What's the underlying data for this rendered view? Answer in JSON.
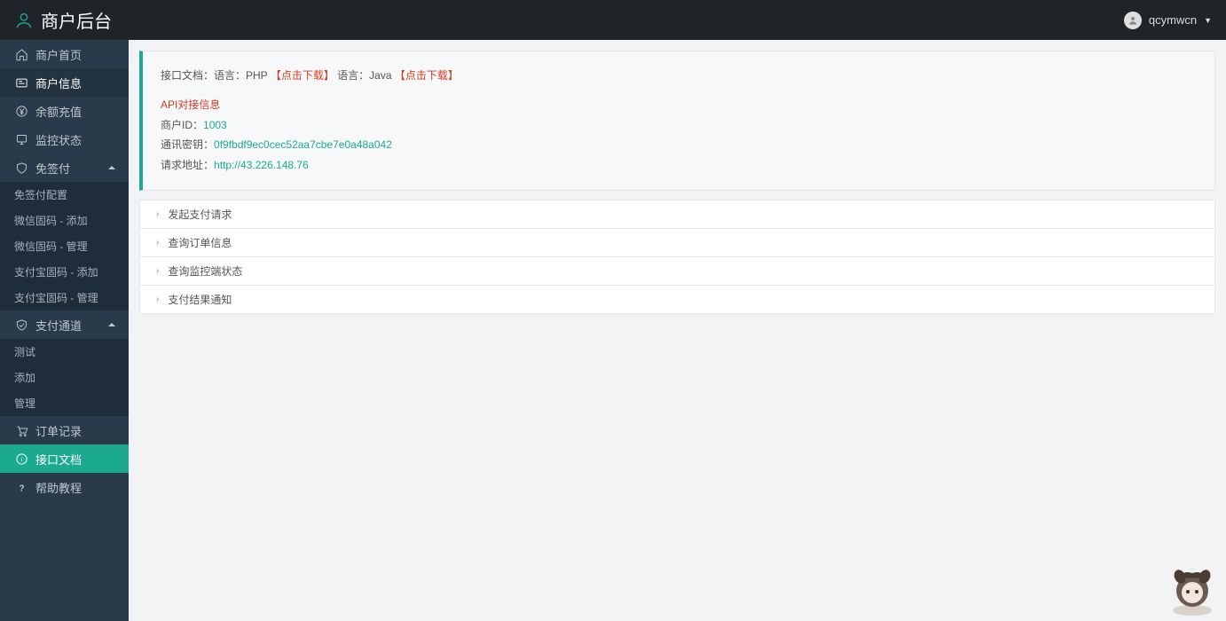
{
  "header": {
    "title": "商户后台",
    "user": "qcymwcn"
  },
  "sidebar": {
    "items": [
      {
        "icon": "home-icon",
        "label": "商户首页"
      },
      {
        "icon": "card-icon",
        "label": "商户信息",
        "state": "hovered"
      },
      {
        "icon": "yen-icon",
        "label": "余额充值"
      },
      {
        "icon": "monitor-icon",
        "label": "监控状态"
      },
      {
        "icon": "shield-icon",
        "label": "免签付",
        "expand": true
      },
      {
        "sub": true,
        "label": "免签付配置"
      },
      {
        "sub": true,
        "label": "微信固码 - 添加"
      },
      {
        "sub": true,
        "label": "微信固码 - 管理"
      },
      {
        "sub": true,
        "label": "支付宝固码 - 添加"
      },
      {
        "sub": true,
        "label": "支付宝固码 - 管理"
      },
      {
        "icon": "check-icon",
        "label": "支付通道",
        "expand": true
      },
      {
        "sub": true,
        "label": "测试"
      },
      {
        "sub": true,
        "label": "添加"
      },
      {
        "sub": true,
        "label": "管理"
      },
      {
        "icon": "cart-icon",
        "label": "订单记录"
      },
      {
        "icon": "info-icon",
        "label": "接口文档",
        "state": "active"
      },
      {
        "icon": "help-icon",
        "label": "帮助教程"
      }
    ]
  },
  "info": {
    "line1_prefix": "接口文档：语言：PHP",
    "line1_link1": "【点击下载】",
    "line1_mid": "语言：Java",
    "line1_link2": "【点击下载】",
    "api_title": "API对接信息",
    "merchant_label": "商户ID：",
    "merchant_value": "1003",
    "key_label": "通讯密钥：",
    "key_value": "0f9fbdf9ec0cec52aa7cbe7e0a48a042",
    "url_label": "请求地址：",
    "url_value": "http://43.226.148.76"
  },
  "accordion": [
    {
      "title": "发起支付请求"
    },
    {
      "title": "查询订单信息"
    },
    {
      "title": "查询监控端状态"
    },
    {
      "title": "支付结果通知"
    }
  ]
}
